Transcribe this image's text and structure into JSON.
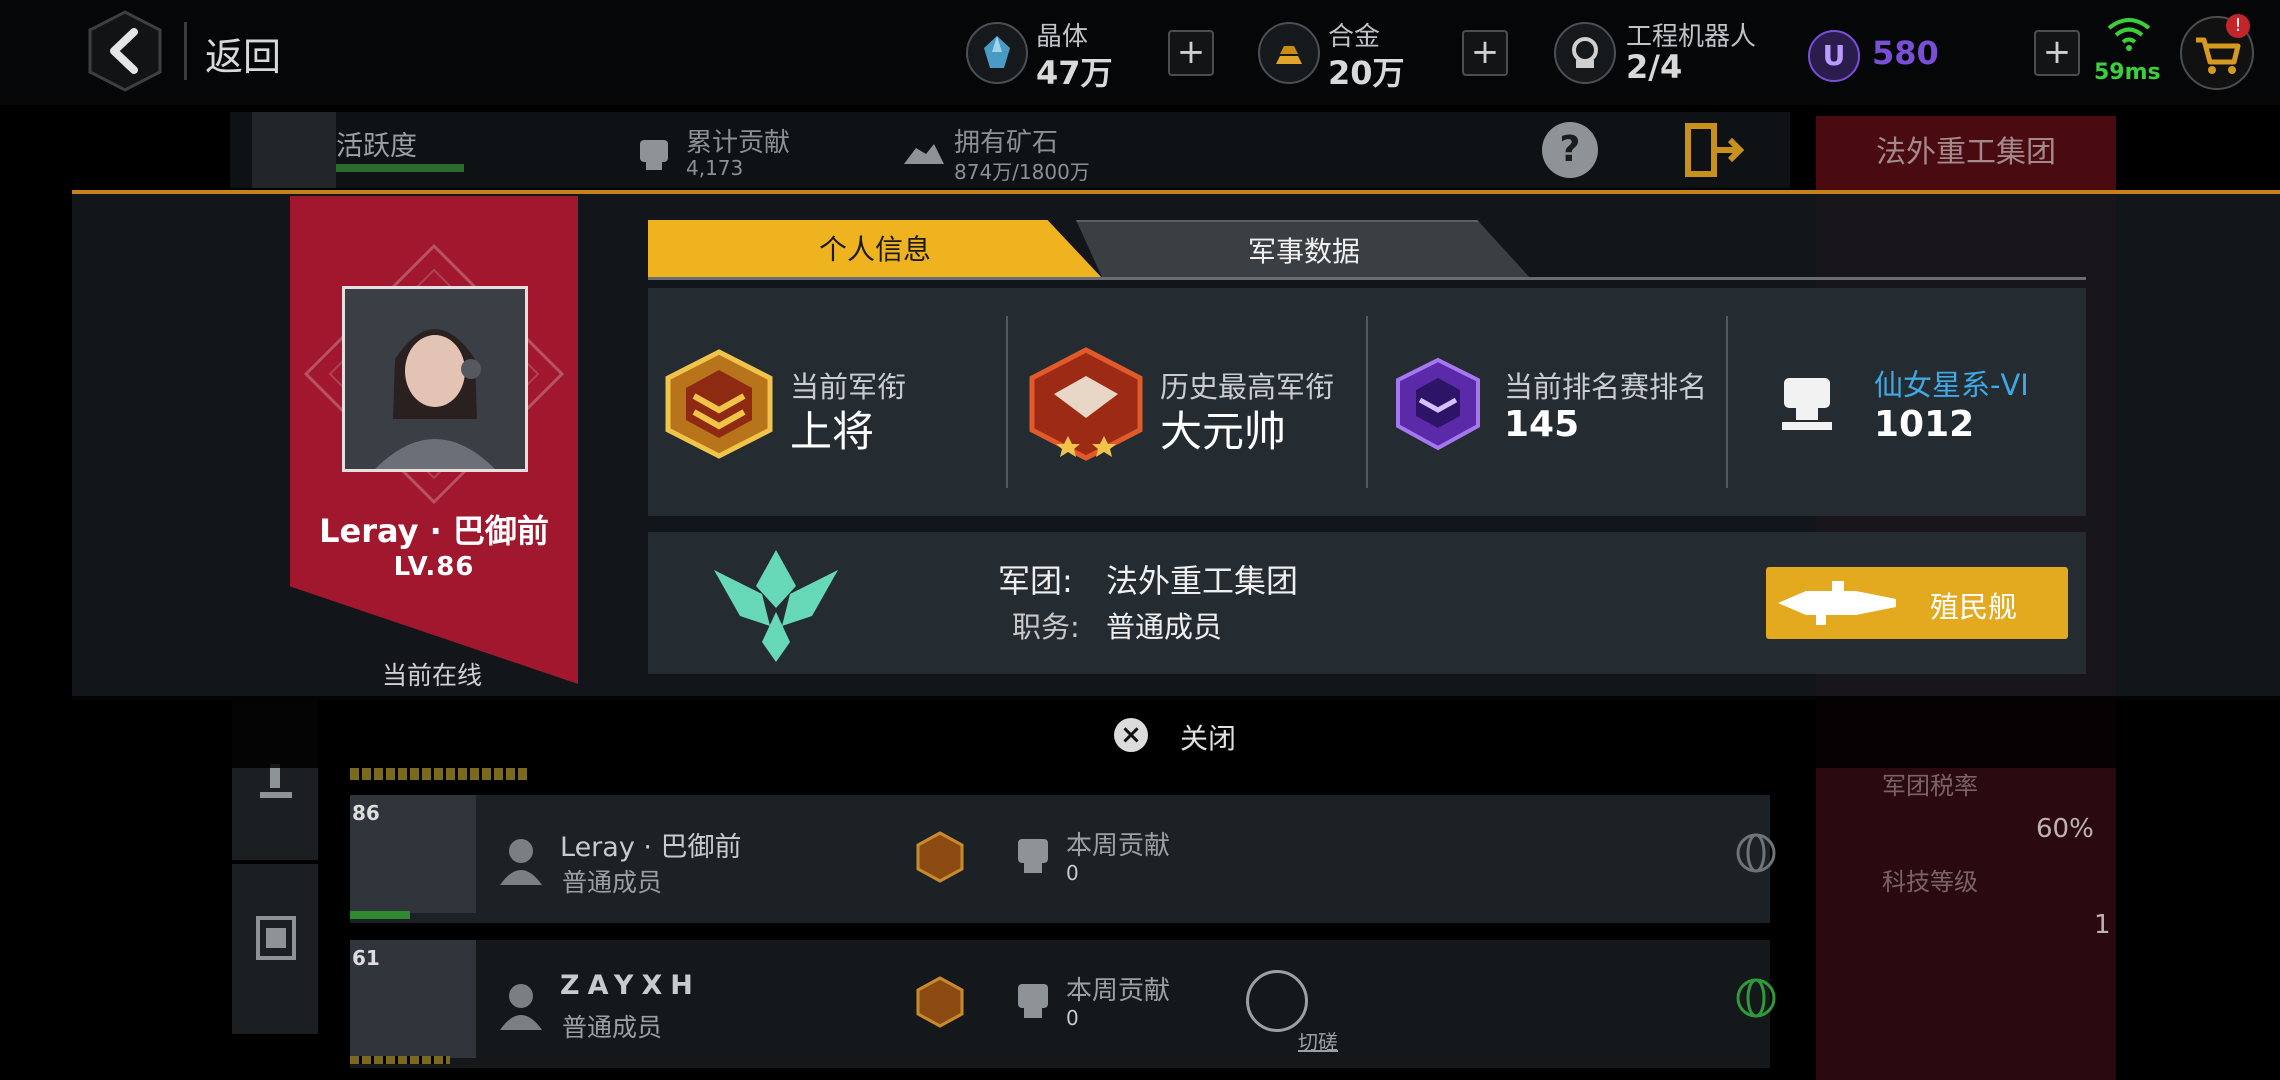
{
  "topbar": {
    "back_label": "返回",
    "resources": [
      {
        "icon": "crystal-icon",
        "label": "晶体",
        "value": "47万"
      },
      {
        "icon": "alloy-icon",
        "label": "合金",
        "value": "20万"
      },
      {
        "icon": "robot-icon",
        "label": "工程机器人",
        "value": "2/4"
      }
    ],
    "u_currency": "580",
    "ping": "59ms"
  },
  "background": {
    "activity_label": "活跃度",
    "contribution_label": "累计贡献",
    "contribution_value": "4,173",
    "ore_label": "拥有矿石",
    "ore_value": "874万/1800万",
    "guild_button": "法外重工集团",
    "tax_label": "军团税率",
    "tax_value": "60%",
    "tech_label": "科技等级",
    "tech_value": "1",
    "members": [
      {
        "level": "86",
        "name": "Leray · 巴御前",
        "role": "普通成员",
        "week_label": "本周贡献",
        "week_value": "0",
        "action": ""
      },
      {
        "level": "61",
        "name": "ZAYXH",
        "role": "普通成员",
        "week_label": "本周贡献",
        "week_value": "0",
        "action": "切磋"
      }
    ]
  },
  "profile": {
    "name": "Leray · 巴御前",
    "level": "LV.86",
    "status": "当前在线",
    "tabs": [
      "个人信息",
      "军事数据"
    ],
    "stats": [
      {
        "label": "当前军衔",
        "value": "上将"
      },
      {
        "label": "历史最高军衔",
        "value": "大元帅"
      },
      {
        "label": "当前排名赛排名",
        "value": "145"
      },
      {
        "label": "仙女星系-VI",
        "value": "1012"
      }
    ],
    "guild_label": "军团:",
    "guild_name": "法外重工集团",
    "duty_label": "职务:",
    "duty_value": "普通成员",
    "colony_button": "殖民舰",
    "close_label": "关闭"
  },
  "colors": {
    "accent_gold": "#f0b320",
    "ribbon_red": "#a0172e",
    "galaxy_blue": "#3fa9e6",
    "u_purple": "#7a4fd8",
    "ping_green": "#3ccf3c"
  }
}
